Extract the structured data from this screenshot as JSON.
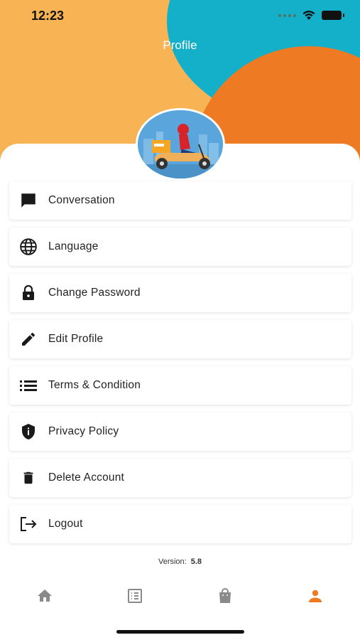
{
  "status_bar": {
    "time": "12:23"
  },
  "header": {
    "title": "Profile"
  },
  "menu": {
    "items": [
      {
        "label": "Conversation",
        "icon": "chat-icon"
      },
      {
        "label": "Language",
        "icon": "globe-icon"
      },
      {
        "label": "Change Password",
        "icon": "lock-icon"
      },
      {
        "label": "Edit Profile",
        "icon": "pencil-icon"
      },
      {
        "label": "Terms & Condition",
        "icon": "list-icon"
      },
      {
        "label": "Privacy Policy",
        "icon": "shield-icon"
      },
      {
        "label": "Delete Account",
        "icon": "trash-icon"
      },
      {
        "label": "Logout",
        "icon": "logout-icon"
      }
    ]
  },
  "footer": {
    "version_label": "Version:",
    "version_value": "5.8"
  },
  "bottom_nav": {
    "items": [
      {
        "name": "home",
        "icon": "home-icon",
        "active": false
      },
      {
        "name": "orders",
        "icon": "list-box-icon",
        "active": false
      },
      {
        "name": "shop",
        "icon": "bag-icon",
        "active": false
      },
      {
        "name": "profile",
        "icon": "person-icon",
        "active": true
      }
    ]
  },
  "colors": {
    "header_yellow": "#f8b454",
    "header_blue": "#14afc9",
    "header_orange": "#ee7a24",
    "nav_active": "#ee7a24",
    "nav_inactive": "#8a8a8a"
  }
}
